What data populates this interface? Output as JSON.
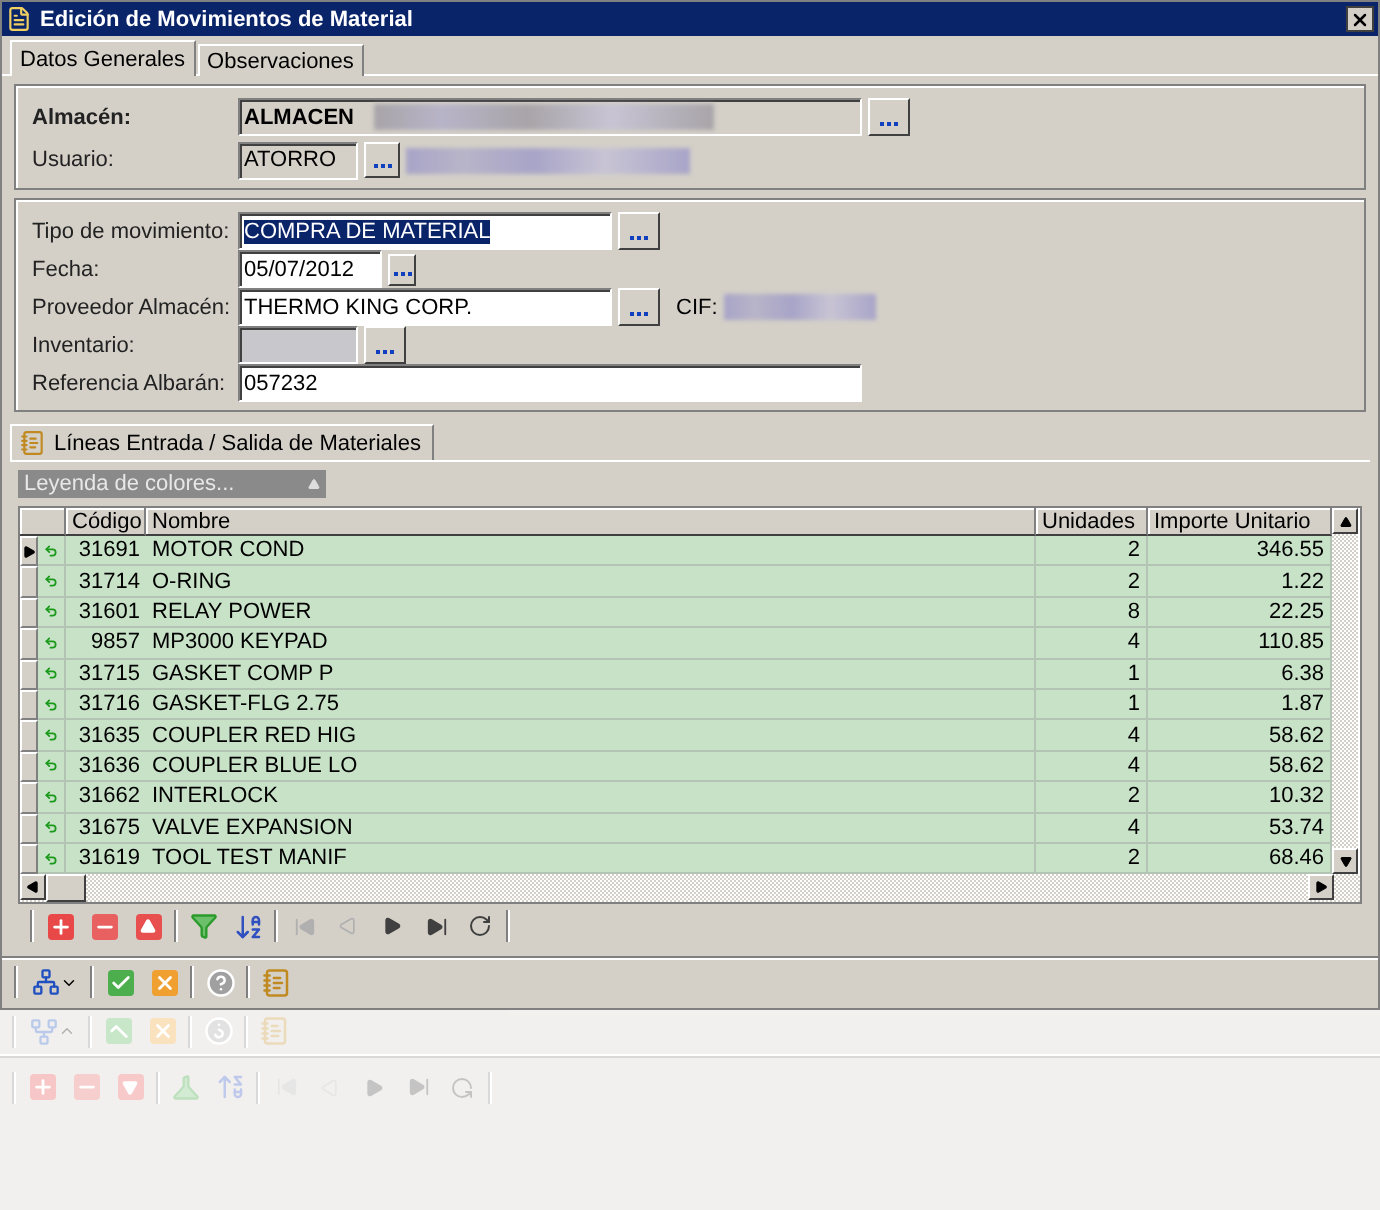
{
  "window": {
    "title": "Edición de Movimientos de Material"
  },
  "tabs": [
    {
      "label": "Datos Generales",
      "selected": true
    },
    {
      "label": "Observaciones",
      "selected": false
    }
  ],
  "almacen": {
    "label": "Almacén:",
    "value": "ALMACEN"
  },
  "usuario": {
    "label": "Usuario:",
    "value": "ATORRO"
  },
  "tipo": {
    "label": "Tipo de movimiento:",
    "value": "COMPRA DE MATERIAL",
    "selected": true
  },
  "fecha": {
    "label": "Fecha:",
    "value": "05/07/2012"
  },
  "proveedor": {
    "label": "Proveedor Almacén:",
    "value": "THERMO KING CORP.",
    "cif_label": "CIF:"
  },
  "inventario": {
    "label": "Inventario:",
    "disabled": true
  },
  "referencia": {
    "label": "Referencia Albarán:",
    "value": "057232"
  },
  "lines_tab": {
    "label": "Líneas Entrada / Salida de Materiales",
    "selected": true
  },
  "legend": {
    "label": "Leyenda de colores..."
  },
  "table": {
    "columns": [
      "Código",
      "Nombre",
      "Unidades",
      "Importe Unitario"
    ],
    "rows": [
      {
        "codigo": "31691",
        "nombre": "MOTOR COND",
        "unidades": "2",
        "importe": "346.55",
        "selected": true
      },
      {
        "codigo": "31714",
        "nombre": "O-RING",
        "unidades": "2",
        "importe": "1.22",
        "selected": false
      },
      {
        "codigo": "31601",
        "nombre": "RELAY POWER",
        "unidades": "8",
        "importe": "22.25",
        "selected": false
      },
      {
        "codigo": "9857",
        "nombre": "MP3000 KEYPAD",
        "unidades": "4",
        "importe": "110.85",
        "selected": false
      },
      {
        "codigo": "31715",
        "nombre": "GASKET COMP P",
        "unidades": "1",
        "importe": "6.38",
        "selected": false
      },
      {
        "codigo": "31716",
        "nombre": "GASKET-FLG 2.75",
        "unidades": "1",
        "importe": "1.87",
        "selected": false
      },
      {
        "codigo": "31635",
        "nombre": "COUPLER RED HIG",
        "unidades": "4",
        "importe": "58.62",
        "selected": false
      },
      {
        "codigo": "31636",
        "nombre": "COUPLER BLUE LO",
        "unidades": "4",
        "importe": "58.62",
        "selected": false
      },
      {
        "codigo": "31662",
        "nombre": "INTERLOCK",
        "unidades": "2",
        "importe": "10.32",
        "selected": false
      },
      {
        "codigo": "31675",
        "nombre": "VALVE EXPANSION",
        "unidades": "4",
        "importe": "53.74",
        "selected": false
      },
      {
        "codigo": "31619",
        "nombre": "TOOL TEST MANIF",
        "unidades": "2",
        "importe": "68.46",
        "selected": false
      }
    ]
  },
  "nav_buttons": [
    {
      "kind": "first",
      "disabled": true
    },
    {
      "kind": "prev",
      "disabled": true
    },
    {
      "kind": "next",
      "disabled": false
    },
    {
      "kind": "last",
      "disabled": false
    },
    {
      "kind": "refresh",
      "disabled": false
    }
  ]
}
